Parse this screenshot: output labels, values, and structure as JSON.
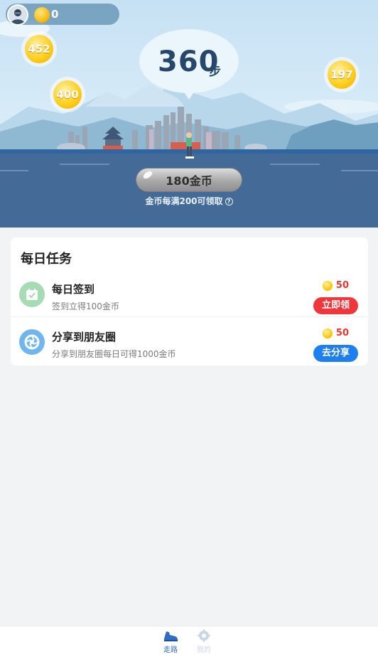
{
  "header": {
    "coin_count": "0"
  },
  "floating_coins": [
    {
      "value": "452"
    },
    {
      "value": "400"
    },
    {
      "value": "197"
    }
  ],
  "steps": {
    "value": "360",
    "unit": "步"
  },
  "collect": {
    "button_label": "180金币",
    "note": "金币每满200可领取",
    "help_glyph": "?"
  },
  "daily_tasks": {
    "title": "每日任务",
    "items": [
      {
        "name": "每日签到",
        "description": "签到立得100金币",
        "reward": "50",
        "button_label": "立即领取",
        "icon": "calendar-check-icon",
        "color": "#f0363a"
      },
      {
        "name": "分享到朋友圈",
        "description": "分享到朋友圈每日可得1000金币",
        "reward": "50",
        "button_label": "去分享",
        "icon": "shutter-icon",
        "color": "#1e7ff0"
      }
    ]
  },
  "tabbar": {
    "items": [
      {
        "label": "走路",
        "icon": "shoe-icon",
        "active": true
      },
      {
        "label": "我的",
        "icon": "gear-icon",
        "active": false
      }
    ]
  },
  "colors": {
    "accent_blue": "#2f6dc7",
    "step_text": "#27466b",
    "reward_red": "#e9352c"
  }
}
